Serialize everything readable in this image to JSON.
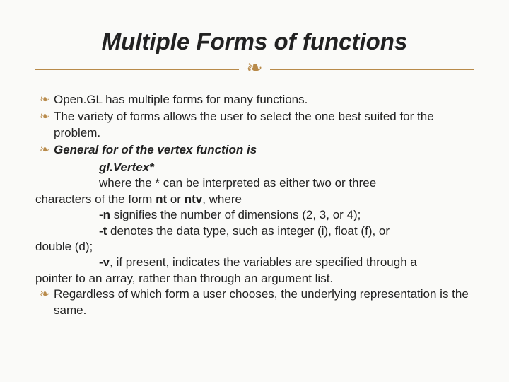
{
  "accent_color": "#b88a4a",
  "title": "Multiple Forms of functions",
  "divider_glyph": "❧",
  "bullet_glyph": "❧",
  "bullets": [
    "Open.GL has multiple forms for many functions.",
    "The variety of forms allows the user to select the one best suited for the problem."
  ],
  "bullet3_prefix": "General for of the vertex function is",
  "line_glvertex": "gl.Vertex*",
  "line_where_prefix": "where the * can be interpreted as either two or three",
  "line_chars_prefix": "characters of the form ",
  "nt": "nt",
  "or_word": " or ",
  "ntv": "ntv",
  "line_chars_suffix": ", where",
  "dash_n": "-n",
  "n_text": " signifies the number of dimensions (2, 3, or 4);",
  "dash_t": "-t",
  "t_text": " denotes the data type, such as integer (i), float (f), or",
  "double_line": "double (d);",
  "dash_v": "-v",
  "v_text": ", if present, indicates the variables are specified through a",
  "pointer_line": "pointer to an array, rather than through an argument list.",
  "bullet4": "Regardless of which form a user chooses, the underlying representation is the same."
}
